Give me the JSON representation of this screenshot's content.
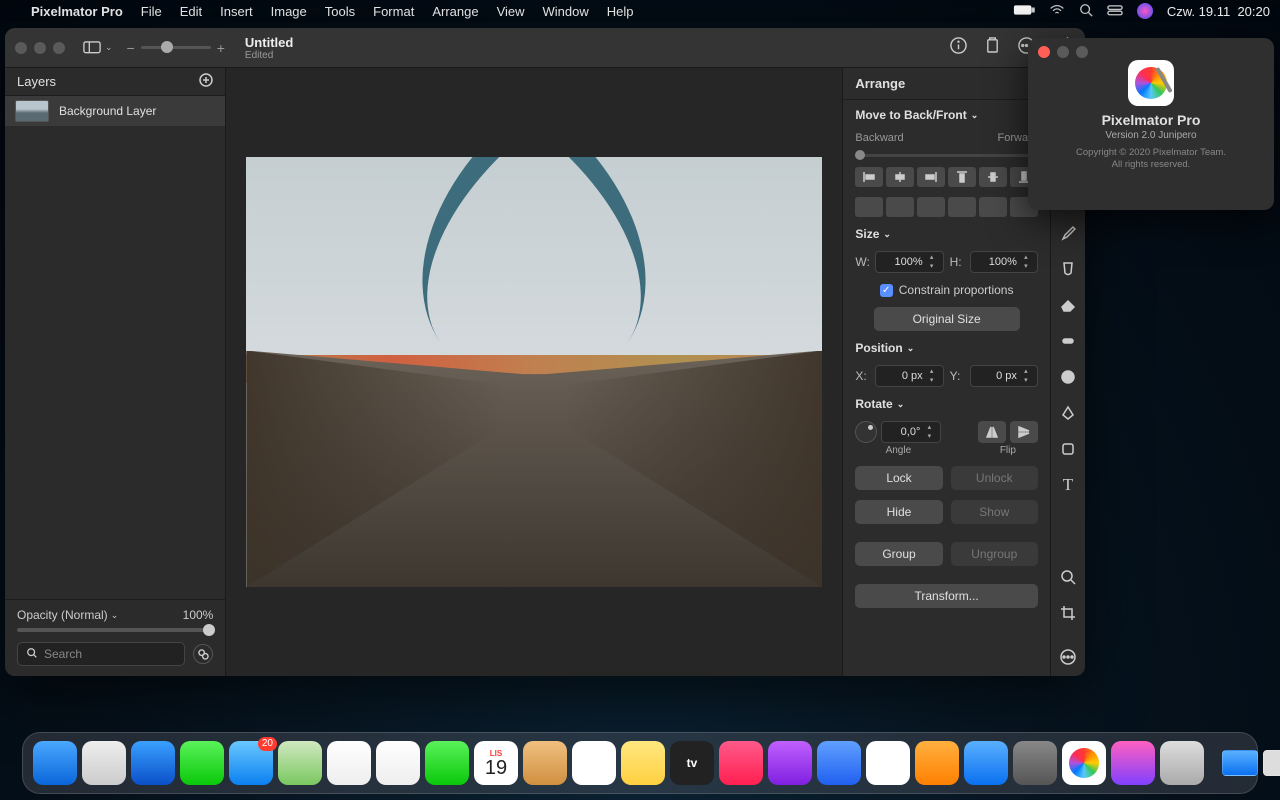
{
  "menubar": {
    "app_name": "Pixelmator Pro",
    "items": [
      "File",
      "Edit",
      "Insert",
      "Image",
      "Tools",
      "Format",
      "Arrange",
      "View",
      "Window",
      "Help"
    ],
    "status": {
      "day": "Czw.",
      "date": "19.11",
      "time": "20:20"
    }
  },
  "titlebar": {
    "doc_title": "Untitled",
    "doc_subtitle": "Edited"
  },
  "layers": {
    "title": "Layers",
    "items": [
      {
        "name": "Background Layer"
      }
    ],
    "opacity_label": "Opacity (Normal)",
    "opacity_value": "100%",
    "search_placeholder": "Search"
  },
  "arrange": {
    "title": "Arrange",
    "move_label": "Move to Back/Front",
    "backward": "Backward",
    "forward": "Forward",
    "size_label": "Size",
    "w_label": "W:",
    "w_value": "100%",
    "h_label": "H:",
    "h_value": "100%",
    "constrain": "Constrain proportions",
    "original_size": "Original Size",
    "position_label": "Position",
    "x_label": "X:",
    "x_value": "0 px",
    "y_label": "Y:",
    "y_value": "0 px",
    "rotate_label": "Rotate",
    "angle_value": "0,0°",
    "angle_caption": "Angle",
    "flip_caption": "Flip",
    "lock": "Lock",
    "unlock": "Unlock",
    "hide": "Hide",
    "show": "Show",
    "group": "Group",
    "ungroup": "Ungroup",
    "transform": "Transform..."
  },
  "about": {
    "title": "Pixelmator Pro",
    "version": "Version 2.0 Junipero",
    "copyright_1": "Copyright © 2020 Pixelmator Team.",
    "copyright_2": "All rights reserved."
  },
  "tools": [
    "arrow",
    "marquee",
    "lasso",
    "paint",
    "brush",
    "bucket",
    "eraser",
    "eraser2",
    "circle",
    "pen",
    "shape",
    "text",
    "",
    "zoom",
    "crop"
  ],
  "dock": {
    "apps": [
      {
        "name": "finder",
        "bg": "linear-gradient(#4aa8ff,#0a66d8)"
      },
      {
        "name": "launchpad",
        "bg": "linear-gradient(#eee,#ccc)"
      },
      {
        "name": "safari",
        "bg": "linear-gradient(#3aa0ff,#0a50c8)"
      },
      {
        "name": "messages",
        "bg": "linear-gradient(#5af25a,#0ac80a)"
      },
      {
        "name": "mail",
        "bg": "linear-gradient(#6ac8ff,#0a80f0)",
        "badge": "20"
      },
      {
        "name": "maps",
        "bg": "linear-gradient(#d0e8c0,#7ac860)"
      },
      {
        "name": "photos",
        "bg": "linear-gradient(#fff,#eee)"
      },
      {
        "name": "photos2",
        "bg": "linear-gradient(#fff,#eee)"
      },
      {
        "name": "facetime",
        "bg": "linear-gradient(#5af25a,#0ac80a)"
      },
      {
        "name": "calendar",
        "bg": "#fff"
      },
      {
        "name": "contacts",
        "bg": "linear-gradient(#f0c080,#d09040)"
      },
      {
        "name": "reminders",
        "bg": "#fff"
      },
      {
        "name": "notes",
        "bg": "linear-gradient(#ffe880,#ffd040)"
      },
      {
        "name": "tv",
        "bg": "#222"
      },
      {
        "name": "music",
        "bg": "linear-gradient(#ff5a8a,#ff2050)"
      },
      {
        "name": "podcasts",
        "bg": "linear-gradient(#c060ff,#8020e0)"
      },
      {
        "name": "news",
        "bg": "linear-gradient(#60a0ff,#2060f0)"
      },
      {
        "name": "numbers",
        "bg": "#fff"
      },
      {
        "name": "pages",
        "bg": "linear-gradient(#ffb040,#ff8000)"
      },
      {
        "name": "appstore",
        "bg": "linear-gradient(#5ab0ff,#0a70f0)"
      },
      {
        "name": "settings",
        "bg": "linear-gradient(#888,#555)"
      },
      {
        "name": "pixelmator",
        "bg": "#fff"
      },
      {
        "name": "messenger",
        "bg": "linear-gradient(#ff60c0,#8040ff)"
      },
      {
        "name": "preview",
        "bg": "linear-gradient(#ddd,#aaa)"
      }
    ],
    "calendar_month": "LIS",
    "calendar_day": "19"
  }
}
